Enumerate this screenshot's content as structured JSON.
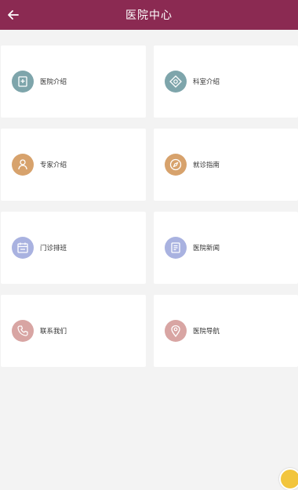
{
  "header": {
    "title": "医院中心",
    "back_icon": "arrow-left-icon"
  },
  "colors": {
    "header_bg": "#8b2a52",
    "float_button": "#f2c53d"
  },
  "menu": [
    {
      "label": "医院介绍",
      "icon": "hospital-icon",
      "color": "#7ea5ab"
    },
    {
      "label": "科室介绍",
      "icon": "department-icon",
      "color": "#7ea5ab"
    },
    {
      "label": "专家介绍",
      "icon": "doctor-icon",
      "color": "#d7a26c"
    },
    {
      "label": "就诊指南",
      "icon": "compass-icon",
      "color": "#d7a26c"
    },
    {
      "label": "门诊排班",
      "icon": "schedule-icon",
      "color": "#a9b2e0"
    },
    {
      "label": "医院新闻",
      "icon": "news-icon",
      "color": "#a9b2e0"
    },
    {
      "label": "联系我们",
      "icon": "phone-icon",
      "color": "#d8a5a3"
    },
    {
      "label": "医院导航",
      "icon": "location-pin-icon",
      "color": "#d8a5a3"
    }
  ]
}
